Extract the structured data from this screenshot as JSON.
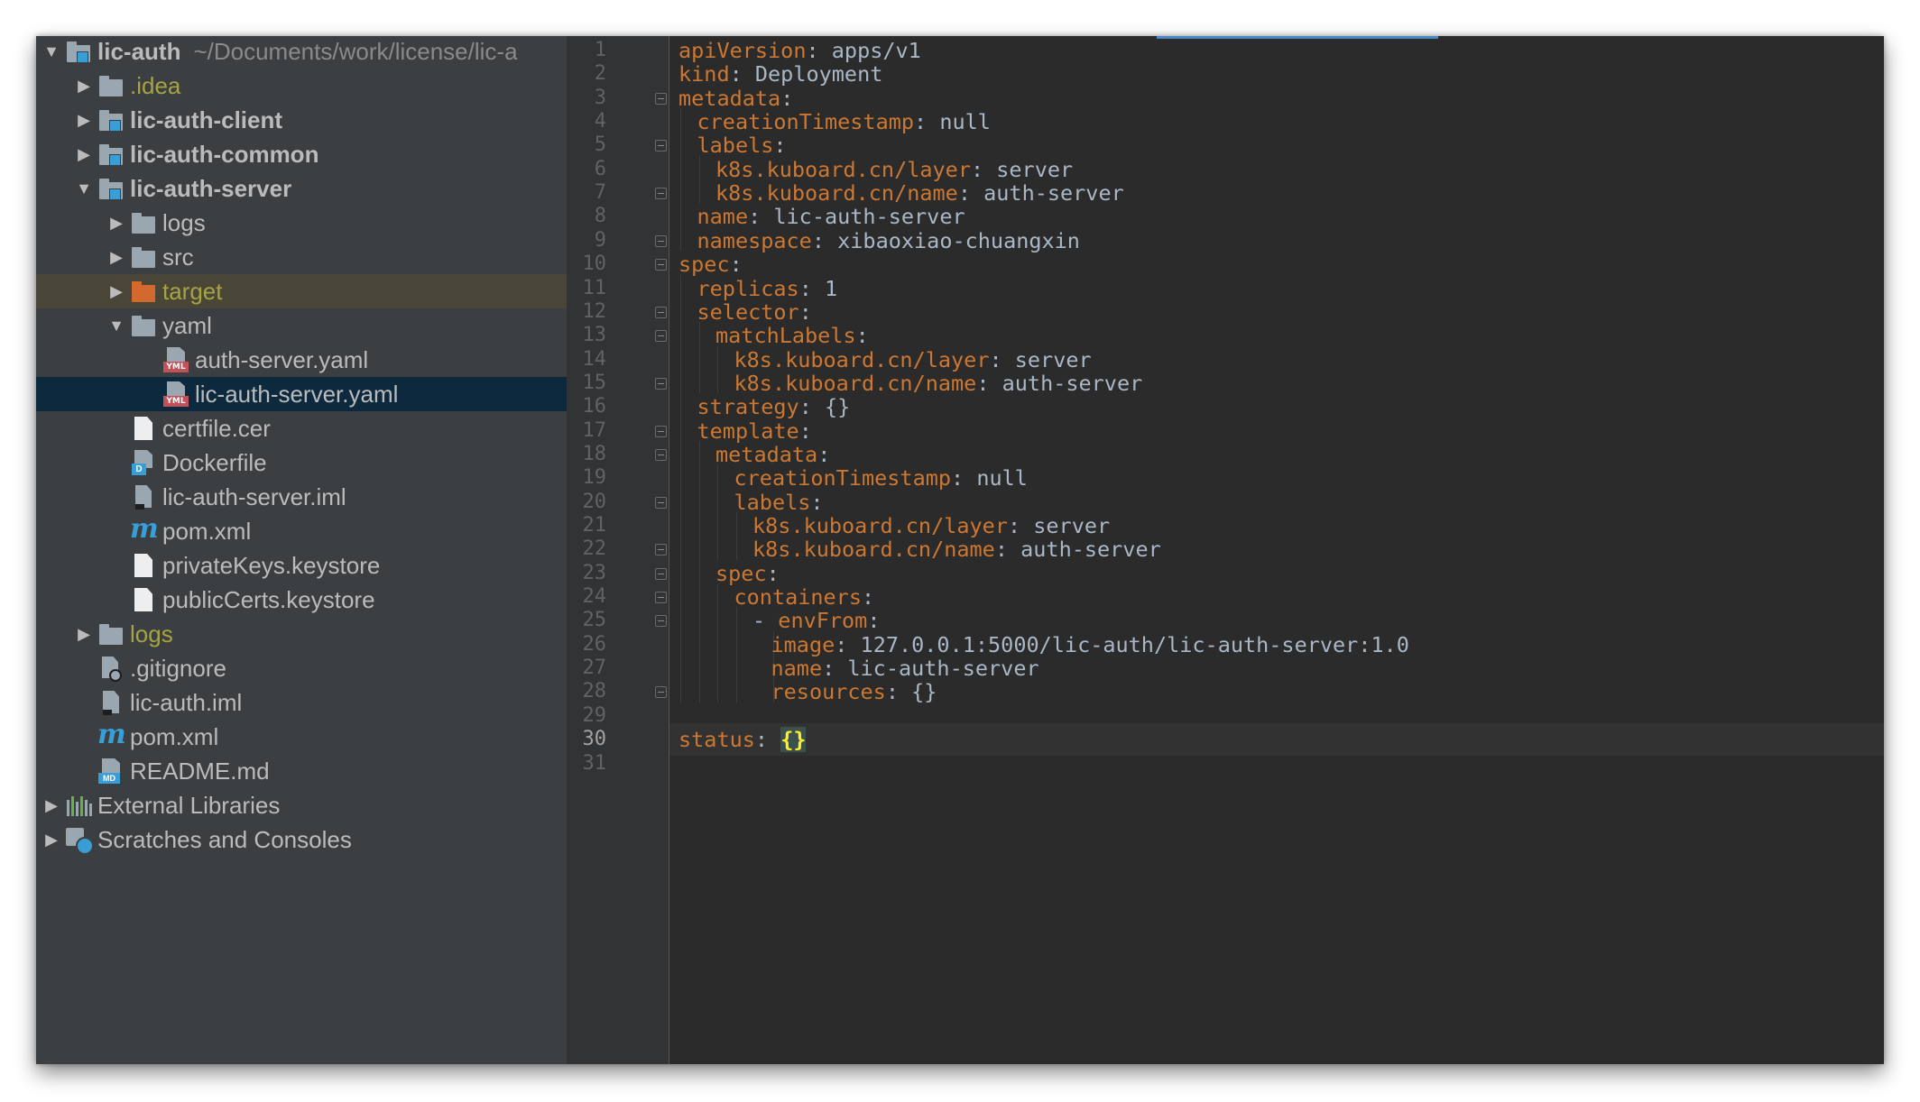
{
  "project_tree": [
    {
      "label": "lic-auth",
      "hint": "~/Documents/work/license/lic-a",
      "icon": "module-icon",
      "arrow": "expanded",
      "depth": 0,
      "style": "bold"
    },
    {
      "label": ".idea",
      "icon": "folder-icon",
      "arrow": "collapsed",
      "depth": 1,
      "style": "yellow"
    },
    {
      "label": "lic-auth-client",
      "icon": "module-icon",
      "arrow": "collapsed",
      "depth": 1,
      "style": "bold"
    },
    {
      "label": "lic-auth-common",
      "icon": "module-icon",
      "arrow": "collapsed",
      "depth": 1,
      "style": "bold"
    },
    {
      "label": "lic-auth-server",
      "icon": "module-icon",
      "arrow": "expanded",
      "depth": 1,
      "style": "bold"
    },
    {
      "label": "logs",
      "icon": "folder-icon",
      "arrow": "collapsed",
      "depth": 2,
      "style": ""
    },
    {
      "label": "src",
      "icon": "folder-icon",
      "arrow": "collapsed",
      "depth": 2,
      "style": ""
    },
    {
      "label": "target",
      "icon": "folder-orange-icon",
      "arrow": "collapsed",
      "depth": 2,
      "style": "yellow",
      "highlighted": true
    },
    {
      "label": "yaml",
      "icon": "folder-icon",
      "arrow": "expanded",
      "depth": 2,
      "style": ""
    },
    {
      "label": "auth-server.yaml",
      "icon": "yaml-file-icon",
      "arrow": "",
      "depth": 3,
      "style": ""
    },
    {
      "label": "lic-auth-server.yaml",
      "icon": "yaml-file-icon",
      "arrow": "",
      "depth": 3,
      "style": "",
      "selected": true
    },
    {
      "label": "certfile.cer",
      "icon": "file-icon",
      "arrow": "",
      "depth": 2,
      "style": ""
    },
    {
      "label": "Dockerfile",
      "icon": "docker-file-icon",
      "arrow": "",
      "depth": 2,
      "style": ""
    },
    {
      "label": "lic-auth-server.iml",
      "icon": "iml-file-icon",
      "arrow": "",
      "depth": 2,
      "style": ""
    },
    {
      "label": "pom.xml",
      "icon": "maven-icon",
      "arrow": "",
      "depth": 2,
      "style": ""
    },
    {
      "label": "privateKeys.keystore",
      "icon": "file-icon",
      "arrow": "",
      "depth": 2,
      "style": ""
    },
    {
      "label": "publicCerts.keystore",
      "icon": "file-icon",
      "arrow": "",
      "depth": 2,
      "style": ""
    },
    {
      "label": "logs",
      "icon": "folder-icon",
      "arrow": "collapsed",
      "depth": 1,
      "style": "yellow"
    },
    {
      "label": ".gitignore",
      "icon": "gitignore-file-icon",
      "arrow": "",
      "depth": 1,
      "style": ""
    },
    {
      "label": "lic-auth.iml",
      "icon": "iml-file-icon",
      "arrow": "",
      "depth": 1,
      "style": ""
    },
    {
      "label": "pom.xml",
      "icon": "maven-icon",
      "arrow": "",
      "depth": 1,
      "style": ""
    },
    {
      "label": "README.md",
      "icon": "markdown-file-icon",
      "arrow": "",
      "depth": 1,
      "style": ""
    },
    {
      "label": "External Libraries",
      "icon": "libraries-icon",
      "arrow": "collapsed",
      "depth": 0,
      "style": ""
    },
    {
      "label": "Scratches and Consoles",
      "icon": "scratches-icon",
      "arrow": "collapsed",
      "depth": 0,
      "style": ""
    }
  ],
  "editor": {
    "current_line": 30,
    "lines": [
      {
        "n": "1",
        "indent": 0,
        "key": "apiVersion",
        "value": "apps/v1",
        "fold": ""
      },
      {
        "n": "2",
        "indent": 0,
        "key": "kind",
        "value": "Deployment",
        "fold": ""
      },
      {
        "n": "3",
        "indent": 0,
        "key": "metadata",
        "value": "",
        "fold": "open"
      },
      {
        "n": "4",
        "indent": 1,
        "key": "creationTimestamp",
        "value": "null",
        "fold": ""
      },
      {
        "n": "5",
        "indent": 1,
        "key": "labels",
        "value": "",
        "fold": "open"
      },
      {
        "n": "6",
        "indent": 2,
        "key": "k8s.kuboard.cn/layer",
        "value": "server",
        "fold": ""
      },
      {
        "n": "7",
        "indent": 2,
        "key": "k8s.kuboard.cn/name",
        "value": "auth-server",
        "fold": "end"
      },
      {
        "n": "8",
        "indent": 1,
        "key": "name",
        "value": "lic-auth-server",
        "fold": ""
      },
      {
        "n": "9",
        "indent": 1,
        "key": "namespace",
        "value": "xibaoxiao-chuangxin",
        "fold": "end"
      },
      {
        "n": "10",
        "indent": 0,
        "key": "spec",
        "value": "",
        "fold": "open"
      },
      {
        "n": "11",
        "indent": 1,
        "key": "replicas",
        "value": "1",
        "fold": ""
      },
      {
        "n": "12",
        "indent": 1,
        "key": "selector",
        "value": "",
        "fold": "open"
      },
      {
        "n": "13",
        "indent": 2,
        "key": "matchLabels",
        "value": "",
        "fold": "open"
      },
      {
        "n": "14",
        "indent": 3,
        "key": "k8s.kuboard.cn/layer",
        "value": "server",
        "fold": ""
      },
      {
        "n": "15",
        "indent": 3,
        "key": "k8s.kuboard.cn/name",
        "value": "auth-server",
        "fold": "end"
      },
      {
        "n": "16",
        "indent": 1,
        "key": "strategy",
        "value": "{}",
        "fold": ""
      },
      {
        "n": "17",
        "indent": 1,
        "key": "template",
        "value": "",
        "fold": "open"
      },
      {
        "n": "18",
        "indent": 2,
        "key": "metadata",
        "value": "",
        "fold": "open"
      },
      {
        "n": "19",
        "indent": 3,
        "key": "creationTimestamp",
        "value": "null",
        "fold": ""
      },
      {
        "n": "20",
        "indent": 3,
        "key": "labels",
        "value": "",
        "fold": "open"
      },
      {
        "n": "21",
        "indent": 4,
        "key": "k8s.kuboard.cn/layer",
        "value": "server",
        "fold": ""
      },
      {
        "n": "22",
        "indent": 4,
        "key": "k8s.kuboard.cn/name",
        "value": "auth-server",
        "fold": "end"
      },
      {
        "n": "23",
        "indent": 2,
        "key": "spec",
        "value": "",
        "fold": "open"
      },
      {
        "n": "24",
        "indent": 3,
        "key": "containers",
        "value": "",
        "fold": "open"
      },
      {
        "n": "25",
        "indent": 4,
        "key": "envFrom",
        "value": "",
        "dash": true,
        "fold": "open"
      },
      {
        "n": "26",
        "indent": 5,
        "key": "image",
        "value": "127.0.0.1:5000/lic-auth/lic-auth-server:1.0",
        "fold": ""
      },
      {
        "n": "27",
        "indent": 5,
        "key": "name",
        "value": "lic-auth-server",
        "fold": ""
      },
      {
        "n": "28",
        "indent": 5,
        "key": "resources",
        "value": "{}",
        "fold": "end"
      },
      {
        "n": "29",
        "indent": 0,
        "key": "",
        "value": "",
        "fold": ""
      },
      {
        "n": "30",
        "indent": 0,
        "key": "status",
        "value": "{}",
        "fold": "",
        "brace_highlight": true
      },
      {
        "n": "31",
        "indent": 0,
        "key": "",
        "value": "",
        "fold": ""
      }
    ]
  }
}
